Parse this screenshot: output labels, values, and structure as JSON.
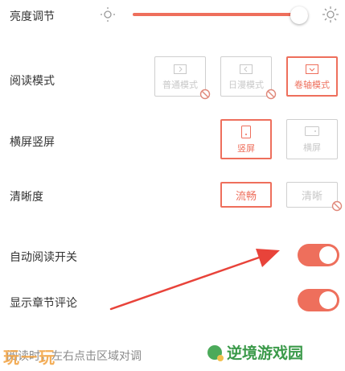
{
  "brightness": {
    "label": "亮度调节",
    "level": 0.95,
    "low_icon": "sun-dim-icon",
    "high_icon": "sun-bright-icon"
  },
  "reading_mode": {
    "label": "阅读模式",
    "options": [
      {
        "label": "普通模式",
        "icon": "page-right-icon",
        "disabled": true
      },
      {
        "label": "日漫模式",
        "icon": "page-left-icon",
        "disabled": true
      },
      {
        "label": "卷轴模式",
        "icon": "scroll-down-icon",
        "selected": true
      }
    ]
  },
  "orientation": {
    "label": "横屏竖屏",
    "options": [
      {
        "label": "竖屏",
        "icon": "portrait-phone-icon",
        "selected": true
      },
      {
        "label": "横屏",
        "icon": "landscape-phone-icon"
      }
    ]
  },
  "clarity": {
    "label": "清晰度",
    "options": [
      {
        "label": "流畅",
        "selected": true
      },
      {
        "label": "清晰",
        "disabled": true
      }
    ]
  },
  "auto_read": {
    "label": "自动阅读开关",
    "on": true
  },
  "chapter_comments": {
    "label": "显示章节评论",
    "on": true
  },
  "footer": {
    "hint": "阅读时，左右点击区域对调"
  },
  "watermarks": {
    "left": "玩一玩",
    "right": "逆境游戏园"
  },
  "colors": {
    "accent": "#ee6f5c",
    "disabled": "#c8c8c8"
  }
}
